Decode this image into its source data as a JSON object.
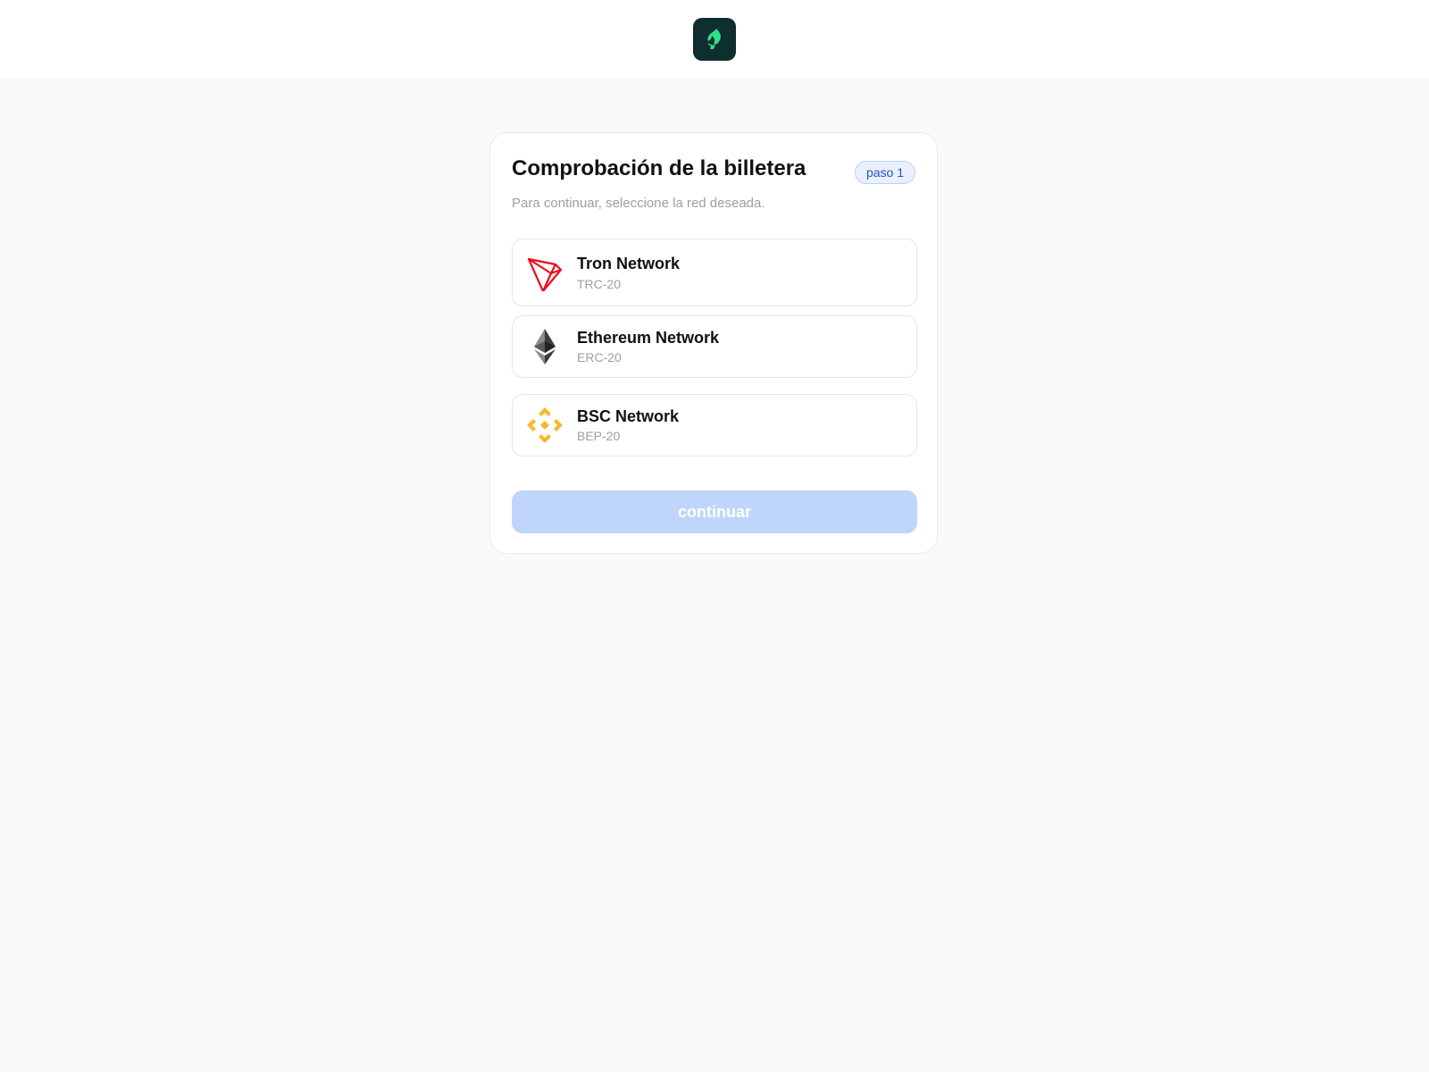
{
  "header": {
    "logo_icon": "spade-flame-logo-icon",
    "logo_bg_color": "#0f2e2e",
    "logo_accent_color": "#2ee08a"
  },
  "card": {
    "title": "Comprobación de la billetera",
    "step_badge": "paso 1",
    "subtitle": "Para continuar, seleccione la red deseada."
  },
  "networks": [
    {
      "name": "Tron Network",
      "standard": "TRC-20",
      "icon": "tron-icon",
      "color": "#ec0c1c"
    },
    {
      "name": "Ethereum Network",
      "standard": "ERC-20",
      "icon": "ethereum-icon",
      "color": "#3c3c3d"
    },
    {
      "name": "BSC Network",
      "standard": "BEP-20",
      "icon": "binance-icon",
      "color": "#f3ba2f"
    }
  ],
  "actions": {
    "continue_label": "continuar",
    "continue_color": "#c0d5fb"
  }
}
